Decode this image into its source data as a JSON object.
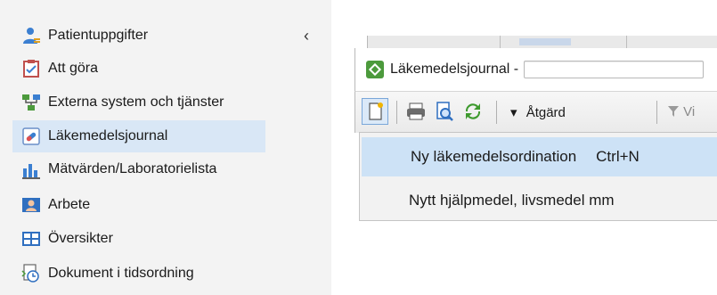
{
  "nav": {
    "items": [
      {
        "label": "Patientuppgifter",
        "icon": "user-icon"
      },
      {
        "label": "Att göra",
        "icon": "checklist-icon"
      },
      {
        "label": "Externa system och tjänster",
        "icon": "network-icon"
      },
      {
        "label": "Läkemedelsjournal",
        "icon": "medicine-icon",
        "selected": true
      },
      {
        "label": "Mätvärden/Laboratorielista",
        "icon": "lab-chart-icon"
      },
      {
        "label": "Arbete",
        "icon": "work-icon"
      },
      {
        "label": "Översikter",
        "icon": "grid-icon"
      },
      {
        "label": "Dokument i tidsordning",
        "icon": "document-clock-icon"
      }
    ],
    "collapse_glyph": "‹"
  },
  "window": {
    "title": "Läkemedelsjournal -",
    "title_field_value": "",
    "toolbar": {
      "action_menu_label": "Åtgärd",
      "action_menu_arrow": "▾",
      "filter_label_partial": "Vi"
    },
    "menu": {
      "items": [
        {
          "label": "Ny läkemedelsordination",
          "shortcut": "Ctrl+N",
          "highlighted": true
        },
        {
          "label": "Nytt hjälpmedel, livsmedel mm",
          "shortcut": ""
        }
      ]
    }
  },
  "colors": {
    "nav_bg": "#f3f3f3",
    "nav_selected": "#d9e7f6",
    "menu_bg": "#f2f2f2",
    "menu_highlight": "#cde2f6",
    "accent_blue": "#2f6fc0"
  }
}
